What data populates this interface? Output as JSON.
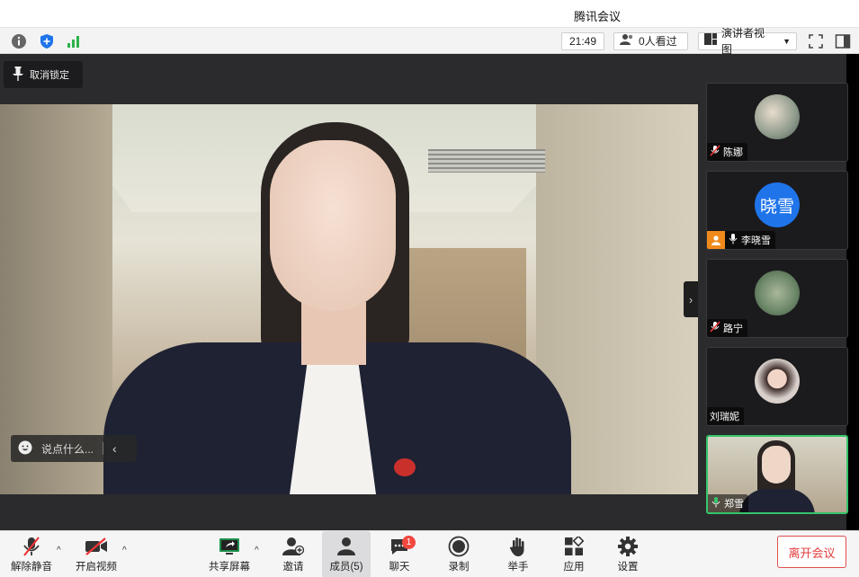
{
  "window": {
    "title": "腾讯会议"
  },
  "infobar": {
    "clock": "21:49",
    "viewers": "0人看过",
    "view_mode": "演讲者视图"
  },
  "stage": {
    "unpin_label": "取消锁定",
    "chat_placeholder": "说点什么..."
  },
  "participants": [
    {
      "name": "陈娜",
      "mic": "muted",
      "avatar": "photo"
    },
    {
      "name": "李晓雪",
      "mic": "on",
      "avatar_text": "晓雪",
      "host": true
    },
    {
      "name": "路宁",
      "mic": "muted",
      "avatar": "photo"
    },
    {
      "name": "刘瑞妮",
      "mic": "none",
      "avatar": "photo"
    },
    {
      "name": "郑雪",
      "mic": "on",
      "avatar": "video",
      "active": true
    }
  ],
  "toolbar": {
    "unmute": "解除静音",
    "start_video": "开启视频",
    "share_screen": "共享屏幕",
    "invite": "邀请",
    "members": "成员(5)",
    "chat": "聊天",
    "chat_badge": "1",
    "record": "录制",
    "raise_hand": "举手",
    "apps": "应用",
    "settings": "设置",
    "leave": "离开会议"
  },
  "colors": {
    "accent_blue": "#1f74ea",
    "speaking_green": "#35c46a",
    "leave_red": "#e23d3d",
    "badge_red": "#f2473e",
    "host_orange": "#f08a1b"
  }
}
